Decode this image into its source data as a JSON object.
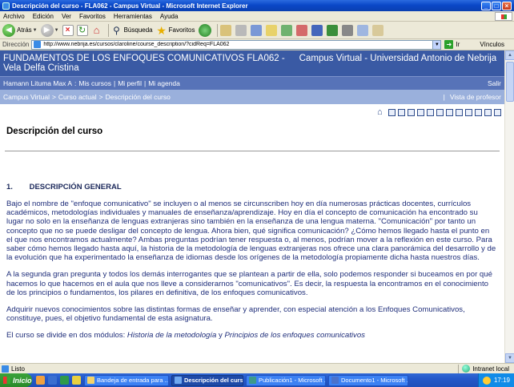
{
  "window": {
    "title": "Descripción del curso - FLA062 - Campus Virtual - Microsoft Internet Explorer",
    "controls": {
      "minimize": "_",
      "maximize": "□",
      "close": "×"
    }
  },
  "menu": [
    "Archivo",
    "Edición",
    "Ver",
    "Favoritos",
    "Herramientas",
    "Ayuda"
  ],
  "toolbar": {
    "back_label": "Atrás",
    "search_label": "Búsqueda",
    "favorites_label": "Favoritos"
  },
  "address": {
    "label": "Dirección",
    "url": "http://www.nebrija.es/cursos/claroline/course_description/?cidReq=FLA062",
    "go_label": "Ir",
    "links_label": "Vínculos"
  },
  "site": {
    "course_title": "FUNDAMENTOS DE LOS ENFOQUES COMUNICATIVOS FLA062 -",
    "campus_title": "Campus Virtual - Universidad Antonio de Nebrija",
    "instructor": "Vela Delfa Cristina",
    "user_bar": {
      "user": "Hamann Lituma Max A",
      "sep": ":",
      "links": [
        "Mis cursos",
        "Mi perfil",
        "Mi agenda"
      ],
      "logout": "Salir"
    },
    "breadcrumb": {
      "items": [
        "Campus Virtual",
        "Curso actual",
        "Descripción del curso"
      ],
      "separator": ">",
      "view_sep": "|",
      "view_label": "Vista de profesor"
    }
  },
  "page": {
    "title": "Descripción del curso",
    "section_number": "1.",
    "section_title": "DESCRIPCIÓN GENERAL",
    "paragraphs": [
      "Bajo el nombre de \"enfoque comunicativo\" se incluyen o al menos se circunscriben  hoy en día numerosas prácticas docentes, currículos académicos, metodologías individuales y manuales de enseñanza/aprendizaje. Hoy en día el concepto de comunicación ha encontrado su lugar no solo en la enseñanza de lenguas extranjeras sino también en la enseñanza de una lengua materna. \"Comunicación\" por tanto un concepto que no se puede desligar del concepto de lengua. Ahora bien, qué significa comunicación? ¿Cómo hemos llegado hasta el punto en el que nos encontramos actualmente? Ambas preguntas podrían tener respuesta o, al menos, podrían mover a la reflexión en este curso. Para saber cómo hemos llegado hasta aquí, la historia de la metodología de lenguas extranjeras nos ofrece una clara panorámica del desarrollo y de la evolución que ha experimentado la enseñanza de idiomas desde los orígenes de la metodología propiamente dicha hasta nuestros días.",
      "A la segunda gran pregunta y todos los demás interrogantes que se plantean a partir de ella, solo podemos responder si buceamos en por qué hacemos lo que hacemos en el aula que nos lleve a considerarnos \"comunicativos\". Es decir, la respuesta la encontramos en el conocimiento de los principios o fundamentos, los pilares en definitiva, de los enfoques comunicativos.",
      "Adquirir nuevos conocimientos sobre las distintas formas de enseñar y aprender, con especial atención a los Enfoques Comunicativos, constituye, pues, el objetivo fundamental de esta asignatura."
    ],
    "modules_intro": "El curso se divide en dos módulos: ",
    "module_1": "Historia de la metodología",
    "module_conj": " y ",
    "module_2": "Principios de los enfoques comunicativos"
  },
  "status": {
    "text": "Listo",
    "zone": "Intranet local"
  },
  "taskbar": {
    "start_label": "Inicio",
    "tasks": [
      "Bandeja de entrada para ...",
      "Descripción del curso ...",
      "Publicación1 - Microsoft ...",
      "Documento1 - Microsoft ..."
    ],
    "clock": "17:19"
  },
  "colors": {
    "header_dark": "#3a5aa4",
    "header_mid": "#5773b8",
    "header_light": "#9ab0dc",
    "body_text": "#1f2e7a"
  }
}
